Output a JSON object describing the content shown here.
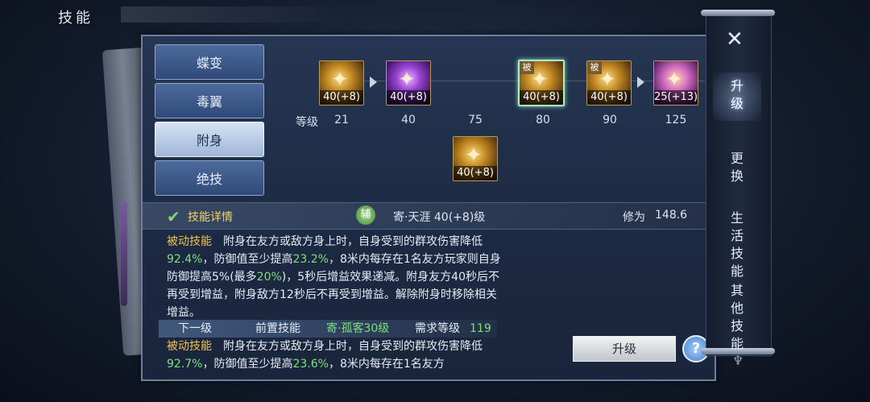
{
  "page_title": "技能",
  "tabs": [
    {
      "label": "蝶变",
      "active": false
    },
    {
      "label": "毒翼",
      "active": false
    },
    {
      "label": "附身",
      "active": true
    },
    {
      "label": "绝技",
      "active": false
    }
  ],
  "skill_icons": [
    {
      "level_text": "40(+8)",
      "badge": "",
      "style": "gold"
    },
    {
      "level_text": "40(+8)",
      "badge": "",
      "style": "purple"
    },
    {
      "level_text": "40(+8)",
      "badge": "被",
      "style": "gold",
      "selected": true
    },
    {
      "level_text": "40(+8)",
      "badge": "被",
      "style": "gold"
    },
    {
      "level_text": "25(+13)",
      "badge": "",
      "style": "pink"
    },
    {
      "level_text": "40(+8)",
      "badge": "",
      "style": "gold"
    }
  ],
  "level_row": {
    "label": "等级",
    "levels": [
      "21",
      "40",
      "75",
      "80",
      "90",
      "125"
    ]
  },
  "detail": {
    "title": "技能详情",
    "aux_label": "辅",
    "skill_name": "寄·天涯 40(+8)级",
    "cultivation_label": "修为",
    "cultivation_value": "148.6"
  },
  "current_desc": {
    "tag": "被动技能",
    "t1": "附身在友方或敌方身上时，自身受到的群攻伤害降低",
    "v1": "92.4%",
    "t2": "，防御值至少提高",
    "v2": "23.2%",
    "t3": "，8米内每存在1名友方玩家则自身防御提高5%(最多",
    "v3": "20%",
    "t4": ")，5秒后增益效果递减。附身友方40秒后不再受到增益，附身敌方12秒后不再受到增益。解除附身时移除相关增益。"
  },
  "next_level": {
    "label": "下一级",
    "prereq_label": "前置技能",
    "prereq_value": "寄·孤客30级",
    "req_label": "需求等级",
    "req_value": "119"
  },
  "next_desc": {
    "tag": "被动技能",
    "t1": "附身在友方或敌方身上时，自身受到的群攻伤害降低",
    "v1": "92.7%",
    "t2": "，防御值至少提高",
    "v2": "23.6%",
    "t3": "，8米内每存在1名友方"
  },
  "buttons": {
    "upgrade": "升级",
    "help": "?"
  },
  "side_menu": {
    "items": [
      "升级",
      "更换",
      "生活技能",
      "其他技能"
    ],
    "active_index": 0
  },
  "colors": {
    "highlight_green": "#7fe07a",
    "tag_gold": "#f2c34a"
  }
}
